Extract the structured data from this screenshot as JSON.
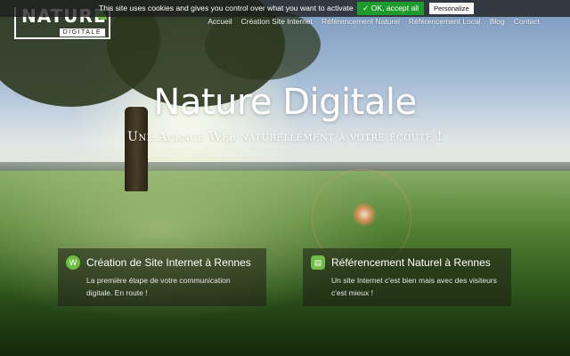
{
  "cookie_bar": {
    "message": "This site uses cookies and gives you control over what you want to activate",
    "accept_label": "✓ OK, accept all",
    "personalize_label": "Personalize"
  },
  "logo": {
    "word": "NATURE",
    "sub": "DIGITALE"
  },
  "nav": {
    "items": [
      {
        "label": "Accueil"
      },
      {
        "label": "Création Site Internet"
      },
      {
        "label": "Référencement Naturel"
      },
      {
        "label": "Référencement Local"
      },
      {
        "label": "Blog"
      },
      {
        "label": "Contact"
      }
    ]
  },
  "hero": {
    "title": "Nature Digitale",
    "subtitle": "Une Agence Web naturellement à votre écoute !"
  },
  "cards": [
    {
      "icon": "wordpress-icon",
      "title": "Création de Site Internet à Rennes",
      "text": "La première étape de votre communication digitale. En route !"
    },
    {
      "icon": "document-icon",
      "title": "Référencement Naturel à Rennes",
      "text": "Un site Internet c'est bien mais avec des visiteurs c'est mieux !"
    }
  ],
  "colors": {
    "accent": "#6cbe45",
    "accept_button": "#1d9b2c"
  }
}
